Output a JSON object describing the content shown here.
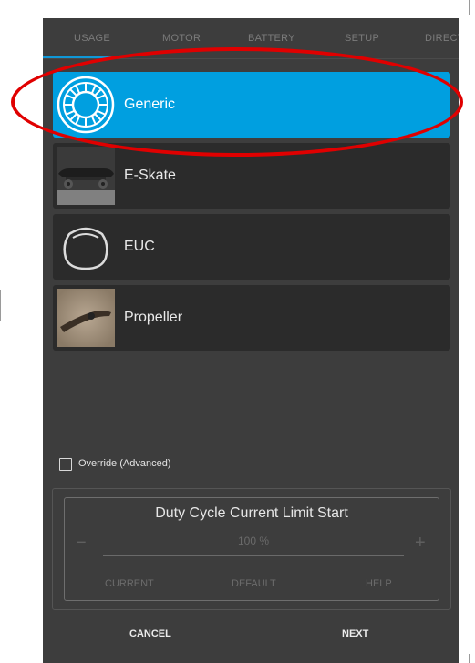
{
  "tabs": [
    {
      "label": "USAGE"
    },
    {
      "label": "MOTOR"
    },
    {
      "label": "BATTERY"
    },
    {
      "label": "SETUP"
    },
    {
      "label": "DIRECT"
    }
  ],
  "usage_items": [
    {
      "label": "Generic",
      "icon": "wheel-icon",
      "selected": true
    },
    {
      "label": "E-Skate",
      "icon": "eskate-image"
    },
    {
      "label": "EUC",
      "icon": "euc-icon"
    },
    {
      "label": "Propeller",
      "icon": "propeller-image"
    }
  ],
  "override": {
    "label": "Override (Advanced)",
    "checked": false
  },
  "param": {
    "title": "Duty Cycle Current Limit Start",
    "value": "100 %",
    "minus": "−",
    "plus": "+",
    "buttons": {
      "current": "CURRENT",
      "default": "DEFAULT",
      "help": "HELP"
    }
  },
  "footer": {
    "cancel": "CANCEL",
    "next": "NEXT"
  },
  "colors": {
    "accent": "#009fe0",
    "highlight": "#e00000",
    "background": "#3d3d3d"
  }
}
